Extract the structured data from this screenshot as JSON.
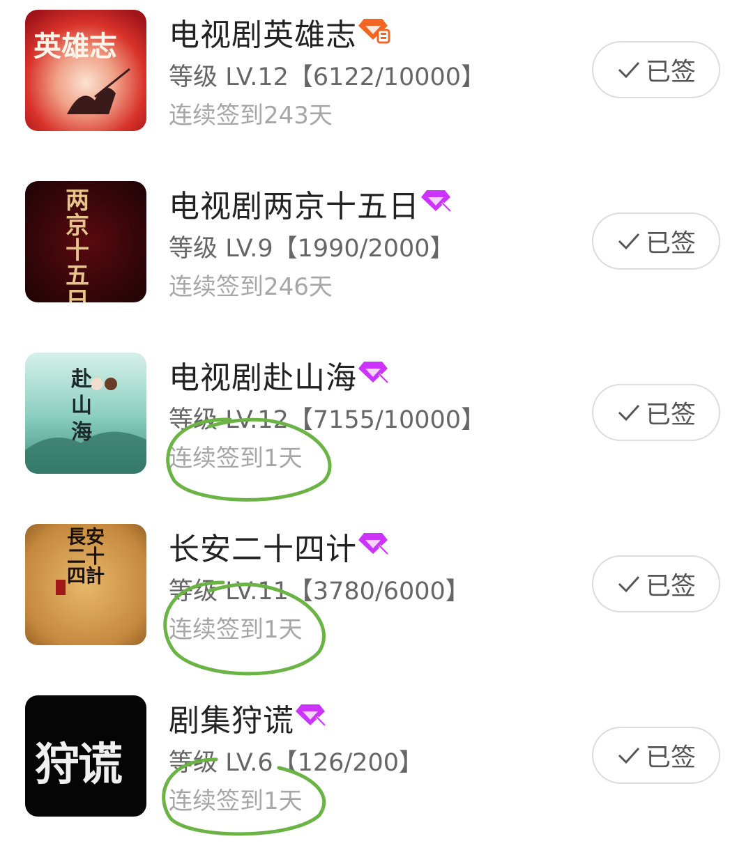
{
  "items": [
    {
      "title": "电视剧英雄志",
      "badge_color": "#f26522",
      "level": "等级 LV.12【6122/10000】",
      "streak": "连续签到243天",
      "button_label": "已签",
      "cover_text": "英雄志"
    },
    {
      "title": "电视剧两京十五日",
      "badge_color": "#cc33ff",
      "level": "等级 LV.9【1990/2000】",
      "streak": "连续签到246天",
      "button_label": "已签",
      "cover_text": "两京十五日"
    },
    {
      "title": "电视剧赴山海",
      "badge_color": "#cc33ff",
      "level": "等级 LV.12【7155/10000】",
      "streak": "连续签到1天",
      "button_label": "已签",
      "cover_text": "赴山海"
    },
    {
      "title": "长安二十四计",
      "badge_color": "#cc33ff",
      "level": "等级 LV.11【3780/6000】",
      "streak": "连续签到1天",
      "button_label": "已签",
      "cover_text": "長安二十四計"
    },
    {
      "title": "剧集狩谎",
      "badge_color": "#cc33ff",
      "level": "等级 LV.6【126/200】",
      "streak": "连续签到1天",
      "button_label": "已签",
      "cover_text": "狩谎"
    }
  ],
  "annotation_color": "#6ab344"
}
